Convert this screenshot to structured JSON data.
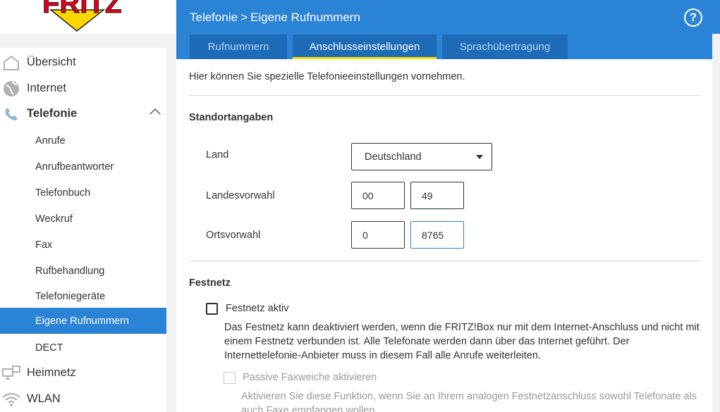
{
  "logo": {
    "text": "FRITZ!"
  },
  "sidebar": {
    "items": [
      {
        "label": "Übersicht",
        "icon": "home-icon"
      },
      {
        "label": "Internet",
        "icon": "globe-icon"
      },
      {
        "label": "Telefonie",
        "icon": "phone-icon",
        "expanded": true
      },
      {
        "label": "Heimnetz",
        "icon": "network-icon"
      },
      {
        "label": "WLAN",
        "icon": "wifi-icon"
      }
    ],
    "subitems": [
      {
        "label": "Anrufe"
      },
      {
        "label": "Anrufbeantworter"
      },
      {
        "label": "Telefonbuch"
      },
      {
        "label": "Weckruf"
      },
      {
        "label": "Fax"
      },
      {
        "label": "Rufbehandlung"
      },
      {
        "label": "Telefoniegeräte"
      },
      {
        "label": "Eigene Rufnummern",
        "active": true
      },
      {
        "label": "DECT"
      }
    ]
  },
  "header": {
    "breadcrumb_parent": "Telefonie",
    "breadcrumb_separator": ">",
    "breadcrumb_current": "Eigene Rufnummern",
    "help": "?"
  },
  "tabs": [
    {
      "label": "Rufnummern",
      "active": false
    },
    {
      "label": "Anschlusseinstellungen",
      "active": true
    },
    {
      "label": "Sprachübertragung",
      "active": false
    }
  ],
  "content": {
    "intro": "Hier können Sie spezielle Telefonieeinstellungen vornehmen.",
    "standort": {
      "title": "Standortangaben",
      "land_label": "Land",
      "land_value": "Deutschland",
      "landesvorwahl_label": "Landesvorwahl",
      "landesvorwahl_prefix": "00",
      "landesvorwahl_value": "49",
      "ortsvorwahl_label": "Ortsvorwahl",
      "ortsvorwahl_prefix": "0",
      "ortsvorwahl_value": "8765"
    },
    "festnetz": {
      "title": "Festnetz",
      "checkbox_label": "Festnetz aktiv",
      "checked": false,
      "description": "Das Festnetz kann deaktiviert werden, wenn die FRITZ!Box nur mit dem Internet-Anschluss und nicht mit einem Festnetz verbunden ist. Alle Telefonate werden dann über das Internet geführt. Der Internettelefonie-Anbieter muss in diesem Fall alle Anrufe weiterleiten.",
      "fax_label": "Passive Faxweiche aktivieren",
      "fax_checked": false,
      "fax_description": "Aktivieren Sie diese Funktion, wenn Sie an Ihrem analogen Festnetzanschluss sowohl Telefonate als auch Faxe empfangen wollen."
    }
  },
  "colors": {
    "primary": "#2b83d6",
    "tab_bg": "#1e6bb8",
    "tab_indicator": "#ffe000",
    "logo_red": "#e2001a",
    "logo_yellow": "#ffd700"
  }
}
